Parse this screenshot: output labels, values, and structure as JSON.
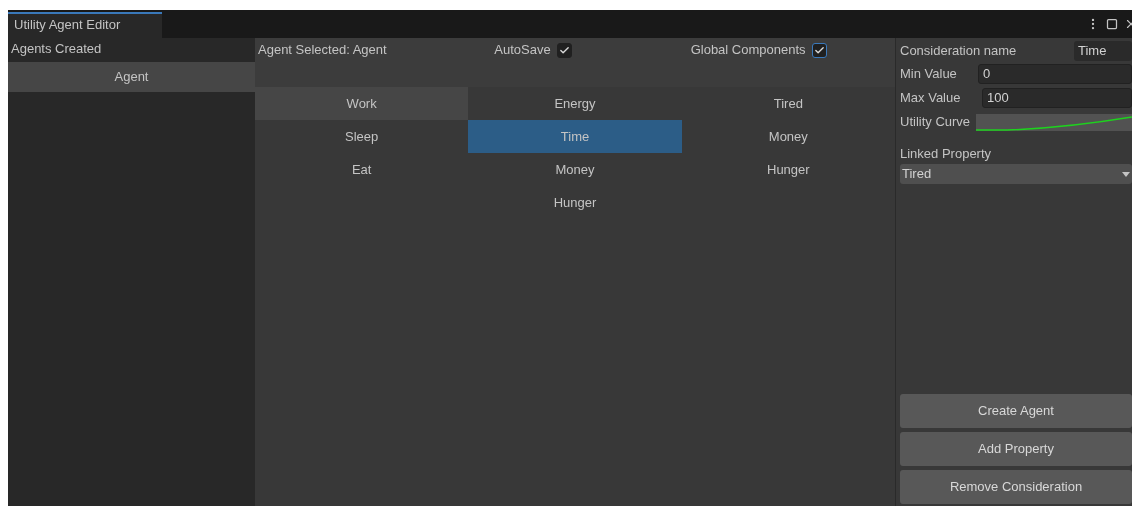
{
  "window": {
    "tab": "Utility Agent Editor"
  },
  "agents": {
    "title": "Agents Created",
    "items": [
      {
        "label": "Agent",
        "selected": true
      }
    ]
  },
  "header": {
    "agent_selected": "Agent Selected: Agent",
    "autosave": {
      "label": "AutoSave",
      "checked": true
    },
    "global_components": {
      "label": "Global Components",
      "checked": true,
      "focused": true
    }
  },
  "columns": [
    {
      "items": [
        {
          "label": "Work",
          "selected": true,
          "focused": false
        },
        {
          "label": "Sleep",
          "selected": false,
          "focused": false
        },
        {
          "label": "Eat",
          "selected": false,
          "focused": false
        }
      ]
    },
    {
      "items": [
        {
          "label": "Energy",
          "selected": false,
          "focused": false
        },
        {
          "label": "Time",
          "selected": true,
          "focused": true
        },
        {
          "label": "Money",
          "selected": false,
          "focused": false
        },
        {
          "label": "Hunger",
          "selected": false,
          "focused": false
        }
      ]
    },
    {
      "items": [
        {
          "label": "Tired",
          "selected": false,
          "focused": false
        },
        {
          "label": "Money",
          "selected": false,
          "focused": false
        },
        {
          "label": "Hunger",
          "selected": false,
          "focused": false
        }
      ]
    }
  ],
  "inspector": {
    "name_label": "Consideration name",
    "name_value": "Time",
    "min_label": "Min Value",
    "min_value": "0",
    "max_label": "Max Value",
    "max_value": "100",
    "curve_label": "Utility Curve",
    "linked_label": "Linked Property",
    "linked_value": "Tired"
  },
  "buttons": [
    "Create Agent",
    "Add Property",
    "Remove Consideration"
  ]
}
